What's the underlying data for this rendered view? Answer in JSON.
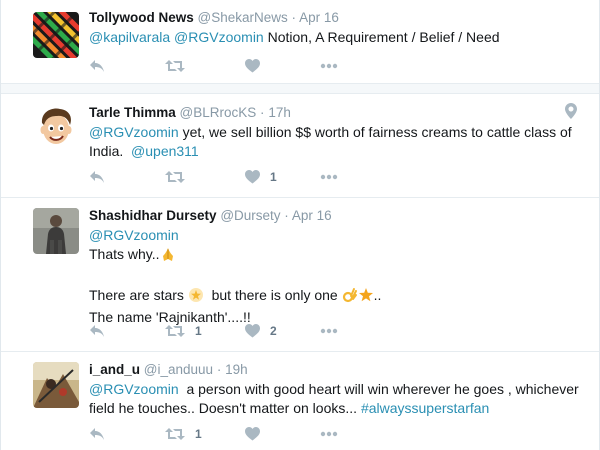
{
  "tweets": [
    {
      "name": "Tollywood News",
      "handle": "@ShekarNews",
      "separator": "·",
      "time": "Apr 16",
      "mentions": [
        "@kapilvarala",
        "@RGVzoomin"
      ],
      "text": "Notion, A Requirement / Belief / Need",
      "retweet_count": "",
      "like_count": ""
    },
    {
      "name": "Tarle Thimma",
      "handle": "@BLRrocKS",
      "separator": "·",
      "time": "17h",
      "mention1": "@RGVzoomin",
      "text1": "yet,  we sell billion $$ worth of fairness creams to cattle class of India.",
      "mention2": "@upen311",
      "retweet_count": "",
      "like_count": "1"
    },
    {
      "name": "Shashidhar Dursety",
      "handle": "@Dursety",
      "separator": "·",
      "time": "Apr 16",
      "mention": "@RGVzoomin",
      "line1": "Thats why..",
      "line2a": "There are stars",
      "line2b": "but there is only one",
      "line2c": "..",
      "line3": "The name 'Rajnikanth'....!!",
      "retweet_count": "1",
      "like_count": "2"
    },
    {
      "name": "i_and_u",
      "handle": "@i_anduuu",
      "separator": "·",
      "time": "19h",
      "mention": "@RGVzoomin",
      "text": "a person with good heart will win wherever he goes , whichever field he touches.. Doesn't matter on looks...",
      "hashtag": "#alwayssuperstarfan",
      "retweet_count": "1",
      "like_count": ""
    }
  ],
  "icons": {
    "reply": "reply-icon",
    "retweet": "retweet-icon",
    "like": "heart-icon",
    "more": "more-icon",
    "location": "location-pin-icon"
  },
  "colors": {
    "link": "#2a8fb3",
    "muted": "#8899a6",
    "action": "#aab8c2",
    "separator_bg": "#f5f8fa"
  }
}
